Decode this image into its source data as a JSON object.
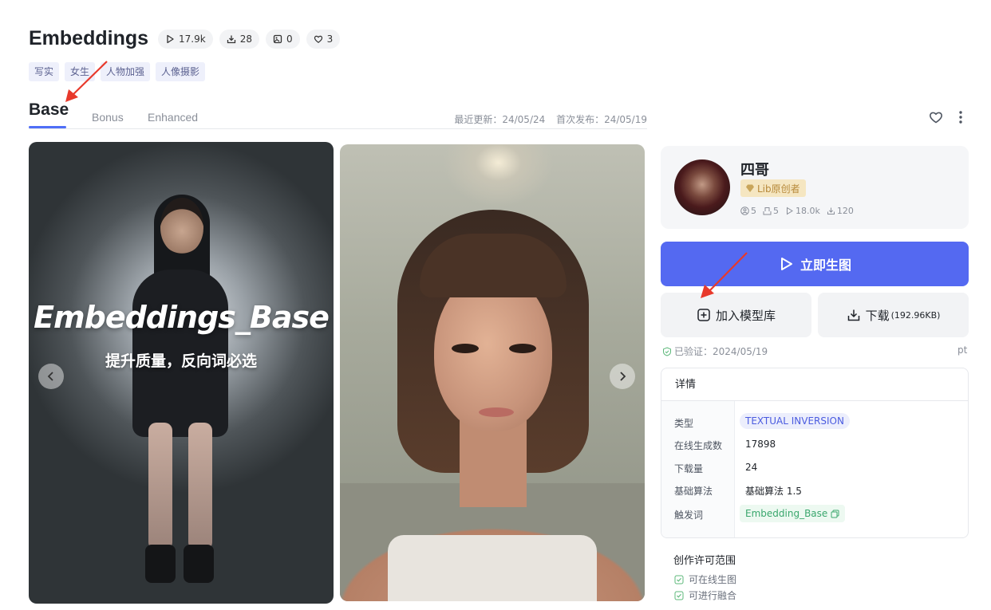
{
  "header": {
    "title": "Embeddings",
    "stats": [
      {
        "icon": "play-icon",
        "value": "17.9k"
      },
      {
        "icon": "download-icon",
        "value": "28"
      },
      {
        "icon": "image-icon",
        "value": "0"
      },
      {
        "icon": "heart-icon",
        "value": "3"
      }
    ],
    "tags": [
      "写实",
      "女生",
      "人物加强",
      "人像摄影"
    ]
  },
  "tabs": {
    "items": [
      "Base",
      "Bonus",
      "Enhanced"
    ],
    "active": "Base",
    "last_updated": "最近更新：24/05/24",
    "first_published": "首次发布：24/05/19"
  },
  "gallery": {
    "overlay_title": "Embeddings_Base",
    "overlay_subtitle": "提升质量，反向词必选"
  },
  "creator": {
    "name": "四哥",
    "badge": "Lib原创者",
    "stats": [
      {
        "icon": "user-icon",
        "value": "5"
      },
      {
        "icon": "model-icon",
        "value": "5"
      },
      {
        "icon": "play-icon",
        "value": "18.0k"
      },
      {
        "icon": "download-icon",
        "value": "120"
      }
    ]
  },
  "actions": {
    "generate_label": "立即生图",
    "add_library_label": "加入模型库",
    "download_label": "下载",
    "download_size": "(192.96KB)"
  },
  "verified": {
    "text": "已验证：2024/05/19",
    "suffix": "pt"
  },
  "details": {
    "heading": "详情",
    "rows": [
      {
        "label": "类型",
        "value": "TEXTUAL INVERSION"
      },
      {
        "label": "在线生成数",
        "value": "17898"
      },
      {
        "label": "下载量",
        "value": "24"
      },
      {
        "label": "基础算法",
        "value": "基础算法 1.5"
      },
      {
        "label": "触发词",
        "value": "Embedding_Base"
      }
    ]
  },
  "license": {
    "title": "创作许可范围",
    "items": [
      "可在线生图",
      "可进行融合"
    ]
  },
  "colors": {
    "accent": "#5469f1",
    "tag_bg": "#eef0fb",
    "trigger_green": "#3aa76d",
    "badge_gold": "#b7893a",
    "annotation_arrow": "#e8392b"
  }
}
